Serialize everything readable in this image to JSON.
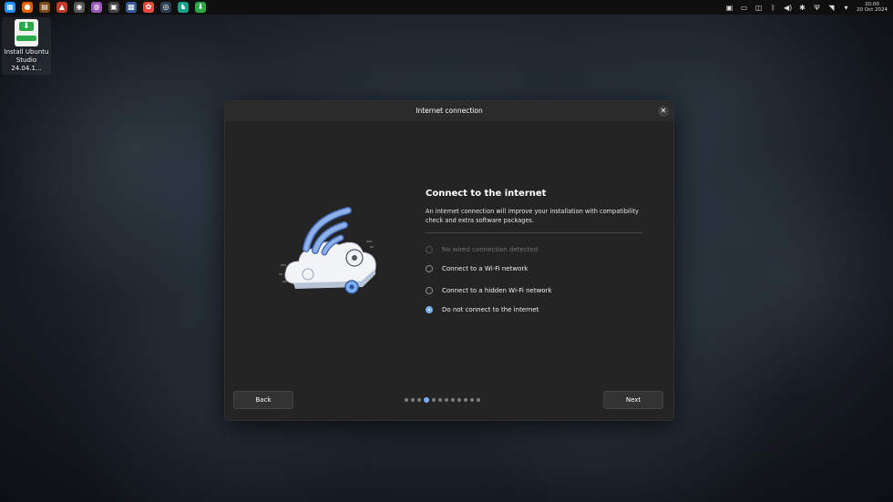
{
  "topbar": {
    "apps": [
      {
        "name": "files-icon",
        "color": "#1e90ff",
        "glyph": "▦"
      },
      {
        "name": "firefox-icon",
        "color": "#e66000",
        "glyph": "●"
      },
      {
        "name": "app3-icon",
        "color": "#7a4a1a",
        "glyph": "▤"
      },
      {
        "name": "ardour-icon",
        "color": "#c0392b",
        "glyph": "▲"
      },
      {
        "name": "app5-icon",
        "color": "#555",
        "glyph": "◉"
      },
      {
        "name": "app6-icon",
        "color": "#9b59b6",
        "glyph": "◍"
      },
      {
        "name": "app7-icon",
        "color": "#444",
        "glyph": "▣"
      },
      {
        "name": "app8-icon",
        "color": "#3b5998",
        "glyph": "▩"
      },
      {
        "name": "app9-icon",
        "color": "#e74c3c",
        "glyph": "✿"
      },
      {
        "name": "app10-icon",
        "color": "#2c3e50",
        "glyph": "◎"
      },
      {
        "name": "app11-icon",
        "color": "#16a085",
        "glyph": "♞"
      },
      {
        "name": "installer-icon",
        "color": "#2aa84a",
        "glyph": "⬇"
      }
    ],
    "clock_time": "20:00",
    "clock_date": "20 Oct 2024"
  },
  "desktop": {
    "icon_label_line1": "Install Ubuntu",
    "icon_label_line2": "Studio 24.04.1..."
  },
  "window": {
    "title": "Internet connection",
    "heading": "Connect to the internet",
    "description": "An internet connection will improve your installation with compatibility check and extra software packages.",
    "options": [
      {
        "label": "No wired connection detected",
        "state": "disabled"
      },
      {
        "label": "Connect to a Wi-Fi network",
        "state": "unchecked"
      },
      {
        "label": "Connect to a hidden Wi-Fi network",
        "state": "unchecked"
      },
      {
        "label": "Do not connect to the internet",
        "state": "checked"
      }
    ],
    "back_label": "Back",
    "next_label": "Next",
    "progress": {
      "total": 12,
      "current": 4
    }
  },
  "colors": {
    "accent": "#7aaef0",
    "window_bg": "#242424"
  }
}
